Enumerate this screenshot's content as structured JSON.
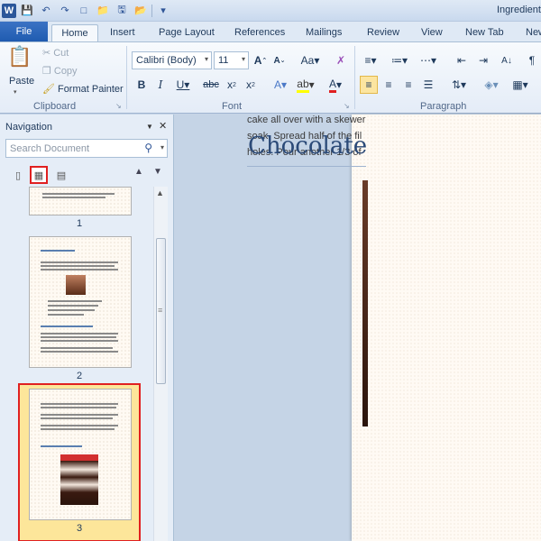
{
  "app": {
    "doc_title": "Ingredients"
  },
  "tabs": [
    "File",
    "Home",
    "Insert",
    "Page Layout",
    "References",
    "Mailings",
    "Review",
    "View",
    "New Tab",
    "New"
  ],
  "clipboard": {
    "paste": "Paste",
    "cut": "Cut",
    "copy": "Copy",
    "format_painter": "Format Painter",
    "label": "Clipboard"
  },
  "font": {
    "name": "Calibri (Body)",
    "size": "11",
    "label": "Font"
  },
  "paragraph": {
    "label": "Paragraph"
  },
  "navigation": {
    "title": "Navigation",
    "search_placeholder": "Search Document",
    "pages": [
      "1",
      "2",
      "3"
    ],
    "selected_page": "3"
  },
  "document": {
    "line1": "cake all over with a skewer",
    "line2": "soak. Spread half of the fil",
    "line3": "holes. Pour another 1/3 of",
    "heading": "Chocolate"
  },
  "colors": {
    "accent": "#2b579a",
    "selection_border": "#e02020",
    "selection_fill": "#fde69a"
  }
}
